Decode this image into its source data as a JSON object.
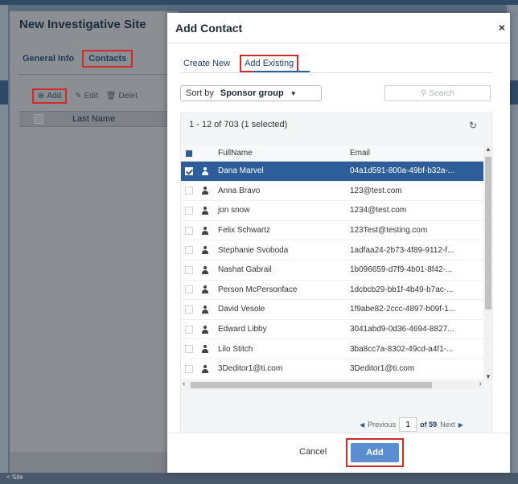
{
  "base": {
    "title": "New Investigative Site",
    "tabs": [
      {
        "label": "General Info"
      },
      {
        "label": "Contacts"
      }
    ],
    "toolbar": {
      "add_label": "Add",
      "edit_label": "Edit",
      "delete_label": "Delet"
    },
    "grid": {
      "header_last_name": "Last Name"
    },
    "bottom_text": "< Site"
  },
  "modal": {
    "title": "Add Contact",
    "close_icon": "×",
    "tabs": [
      {
        "label": "Create New"
      },
      {
        "label": "Add Existing"
      }
    ],
    "sort": {
      "label": "Sort by",
      "value": "Sponsor group",
      "caret": "▼"
    },
    "search": {
      "placeholder": "Search"
    },
    "count_text": "1 - 12 of 703 (1 selected)",
    "columns": {
      "full_name": "FullName",
      "email": "Email"
    },
    "rows": [
      {
        "name": "Dana Marvel",
        "email": "04a1d591-800a-49bf-b32a-...",
        "checked": true
      },
      {
        "name": "Anna Bravo",
        "email": "123@test.com",
        "checked": false
      },
      {
        "name": "jon snow",
        "email": "1234@test.com",
        "checked": false
      },
      {
        "name": "Felix Schwartz",
        "email": "123Test@testing.com",
        "checked": false
      },
      {
        "name": "Stephanie Svoboda",
        "email": "1adfaa24-2b73-4f89-9112-f...",
        "checked": false
      },
      {
        "name": "Nashat Gabrail",
        "email": "1b096659-d7f9-4b01-8f42-...",
        "checked": false
      },
      {
        "name": "Person McPersonface",
        "email": "1dcbcb29-bb1f-4b49-b7ac-...",
        "checked": false
      },
      {
        "name": "David Vesole",
        "email": "1f9abe82-2ccc-4897-b09f-1...",
        "checked": false
      },
      {
        "name": "Edward Libby",
        "email": "3041abd9-0d36-4694-8827...",
        "checked": false
      },
      {
        "name": "Lilo Stitch",
        "email": "3ba8cc7a-8302-49cd-a4f1-...",
        "checked": false
      },
      {
        "name": "3Deditor1@ti.com",
        "email": "3Deditor1@ti.com",
        "checked": false
      }
    ],
    "pager": {
      "previous": "Previous",
      "page": "1",
      "of": "of 59",
      "next": "Next"
    },
    "footer": {
      "cancel": "Cancel",
      "add": "Add"
    }
  },
  "colors": {
    "accent": "#2e5e9a",
    "highlight_box": "#d12a2a",
    "primary_button": "#5a8ed0"
  }
}
